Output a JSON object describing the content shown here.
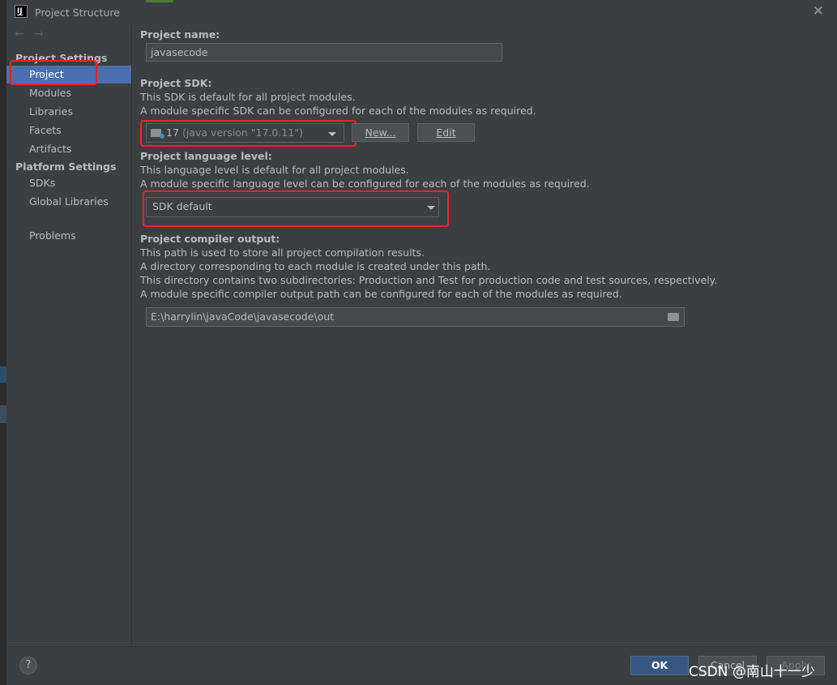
{
  "window": {
    "title": "Project Structure"
  },
  "sidebar": {
    "project_settings_label": "Project Settings",
    "project_items": [
      "Project",
      "Modules",
      "Libraries",
      "Facets",
      "Artifacts"
    ],
    "platform_settings_label": "Platform Settings",
    "platform_items": [
      "SDKs",
      "Global Libraries"
    ],
    "problems_label": "Problems",
    "selected": "Project"
  },
  "project_name": {
    "label": "Project name:",
    "value": "javasecode"
  },
  "project_sdk": {
    "label": "Project SDK:",
    "desc1": "This SDK is default for all project modules.",
    "desc2": "A module specific SDK can be configured for each of the modules as required.",
    "sdk_version": "17",
    "sdk_detail": "(java version \"17.0.11\")",
    "new_button": "New...",
    "edit_button": "Edit"
  },
  "language_level": {
    "label": "Project language level:",
    "desc1": "This language level is default for all project modules.",
    "desc2": "A module specific language level can be configured for each of the modules as required.",
    "value": "SDK default"
  },
  "compiler_output": {
    "label": "Project compiler output:",
    "desc1": "This path is used to store all project compilation results.",
    "desc2": "A directory corresponding to each module is created under this path.",
    "desc3": "This directory contains two subdirectories: Production and Test for production code and test sources, respectively.",
    "desc4": "A module specific compiler output path can be configured for each of the modules as required.",
    "path": "E:\\harrylin\\javaCode\\javasecode\\out"
  },
  "footer": {
    "help": "?",
    "ok": "OK",
    "cancel": "Cancel",
    "apply": "Apply"
  },
  "watermark": "CSDN @南山十一少",
  "colors": {
    "accent_selected": "#4b6eaf",
    "highlight_box": "#ff2020",
    "ok_button": "#365880"
  }
}
